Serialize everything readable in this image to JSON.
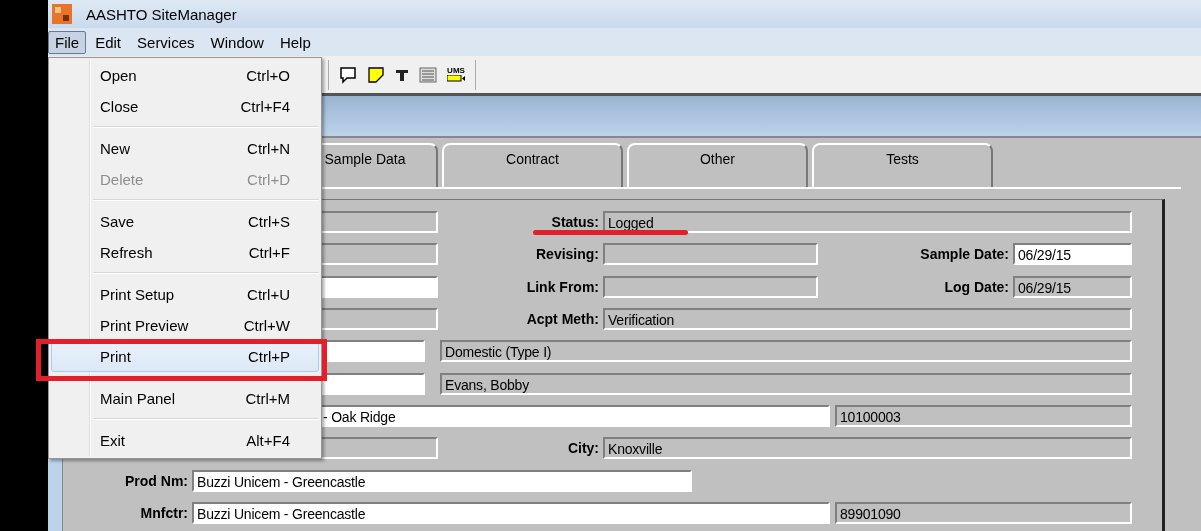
{
  "window": {
    "title": "AASHTO SiteManager"
  },
  "menubar": [
    {
      "label": "File",
      "selected": true
    },
    {
      "label": "Edit",
      "selected": false
    },
    {
      "label": "Services",
      "selected": false
    },
    {
      "label": "Window",
      "selected": false
    },
    {
      "label": "Help",
      "selected": false
    }
  ],
  "toolbar": [
    {
      "kind": "comment"
    },
    {
      "kind": "note"
    },
    {
      "kind": "text"
    },
    {
      "kind": "list"
    },
    {
      "kind": "ums",
      "text": "UMS"
    }
  ],
  "tabs": [
    {
      "label": "Sample Data"
    },
    {
      "label": "Contract"
    },
    {
      "label": "Other"
    },
    {
      "label": "Tests"
    }
  ],
  "form_rows": [
    {
      "items": [
        {
          "kind": "field",
          "editable": false
        },
        {
          "kind": "label",
          "text": "Status:"
        },
        {
          "kind": "field",
          "editable": false,
          "value": "Logged"
        }
      ]
    },
    {
      "items": [
        {
          "kind": "field",
          "editable": false
        },
        {
          "kind": "label",
          "text": "Revising:"
        },
        {
          "kind": "field",
          "editable": false
        },
        {
          "kind": "label",
          "text": "Sample Date:"
        },
        {
          "kind": "field",
          "editable": true,
          "value": "06/29/15"
        }
      ]
    },
    {
      "items": [
        {
          "kind": "field",
          "editable": true
        },
        {
          "kind": "label",
          "text": "Link From:"
        },
        {
          "kind": "field",
          "editable": false
        },
        {
          "kind": "label",
          "text": "Log Date:"
        },
        {
          "kind": "field",
          "editable": false,
          "value": "06/29/15"
        }
      ]
    },
    {
      "items": [
        {
          "kind": "field",
          "editable": false
        },
        {
          "kind": "label",
          "text": "Acpt Meth:"
        },
        {
          "kind": "field",
          "editable": false,
          "value": "Verification"
        }
      ]
    },
    {
      "items": [
        {
          "kind": "field",
          "editable": true
        },
        {
          "kind": "field",
          "editable": false,
          "value": "Domestic (Type I)"
        }
      ]
    },
    {
      "items": [
        {
          "kind": "field",
          "editable": true
        },
        {
          "kind": "field",
          "editable": false,
          "value": "Evans, Bobby"
        }
      ]
    },
    {
      "items": [
        {
          "kind": "field",
          "editable": true,
          "value": "- Oak Ridge"
        },
        {
          "kind": "field",
          "editable": false,
          "value": "10100003"
        }
      ]
    },
    {
      "items": [
        {
          "kind": "field",
          "editable": false
        },
        {
          "kind": "label",
          "text": "City:"
        },
        {
          "kind": "field",
          "editable": false,
          "value": "Knoxville"
        }
      ]
    },
    {
      "items": [
        {
          "kind": "label",
          "text": "Prod Nm:"
        },
        {
          "kind": "field",
          "editable": true,
          "value": "Buzzi Unicem - Greencastle"
        }
      ]
    },
    {
      "items": [
        {
          "kind": "label",
          "text": "Mnfctr:"
        },
        {
          "kind": "field",
          "editable": true,
          "value": "Buzzi Unicem - Greencastle"
        },
        {
          "kind": "field",
          "editable": false,
          "value": "89901090"
        }
      ]
    }
  ],
  "file_menu": [
    {
      "kind": "item",
      "label": "Open",
      "shortcut": "Ctrl+O",
      "disabled": false,
      "selected": false
    },
    {
      "kind": "item",
      "label": "Close",
      "shortcut": "Ctrl+F4",
      "disabled": false,
      "selected": false
    },
    {
      "kind": "separator"
    },
    {
      "kind": "item",
      "label": "New",
      "shortcut": "Ctrl+N",
      "disabled": false,
      "selected": false
    },
    {
      "kind": "item",
      "label": "Delete",
      "shortcut": "Ctrl+D",
      "disabled": true,
      "selected": false
    },
    {
      "kind": "separator"
    },
    {
      "kind": "item",
      "label": "Save",
      "shortcut": "Ctrl+S",
      "disabled": false,
      "selected": false
    },
    {
      "kind": "item",
      "label": "Refresh",
      "shortcut": "Ctrl+F",
      "disabled": false,
      "selected": false
    },
    {
      "kind": "separator"
    },
    {
      "kind": "item",
      "label": "Print Setup",
      "shortcut": "Ctrl+U",
      "disabled": false,
      "selected": false
    },
    {
      "kind": "item",
      "label": "Print Preview",
      "shortcut": "Ctrl+W",
      "disabled": false,
      "selected": false
    },
    {
      "kind": "item",
      "label": "Print",
      "shortcut": "Ctrl+P",
      "disabled": false,
      "selected": true
    },
    {
      "kind": "separator"
    },
    {
      "kind": "item",
      "label": "Main Panel",
      "shortcut": "Ctrl+M",
      "disabled": false,
      "selected": false
    },
    {
      "kind": "separator"
    },
    {
      "kind": "item",
      "label": "Exit",
      "shortcut": "Alt+F4",
      "disabled": false,
      "selected": false
    }
  ]
}
